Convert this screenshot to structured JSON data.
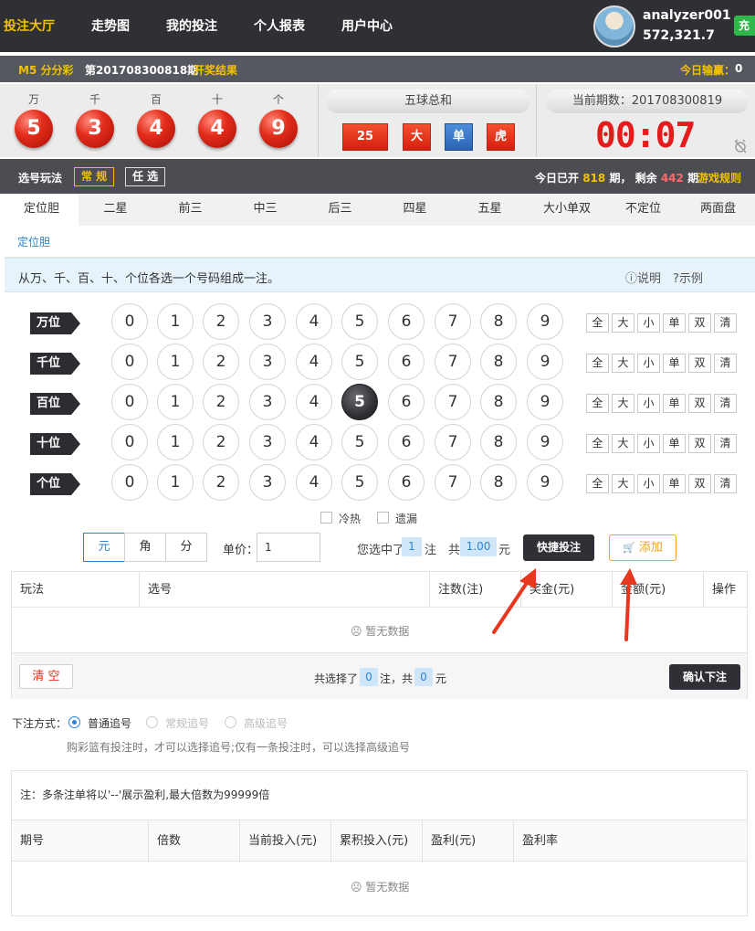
{
  "nav": {
    "items": [
      "投注大厅",
      "走势图",
      "我的投注",
      "个人报表",
      "用户中心"
    ],
    "username": "analyzer001",
    "balance": "572,321.7",
    "recharge": "充"
  },
  "subbar": {
    "game": "M5 分分彩",
    "issue": "第201708300818期",
    "result_label": "开奖结果",
    "today_profit_label": "今日输赢：",
    "today_profit": "0"
  },
  "result": {
    "positions": [
      "万",
      "千",
      "百",
      "十",
      "个"
    ],
    "balls": [
      "5",
      "3",
      "4",
      "4",
      "9"
    ],
    "sum_title": "五球总和",
    "sum_values": [
      "25",
      "大",
      "单",
      "虎"
    ],
    "period_label": "当前期数：201708300819",
    "countdown": "00:07"
  },
  "mode": {
    "label": "选号玩法",
    "normal": "常 规",
    "optional": "任 选",
    "today_prefix": "今日已开",
    "opened": "818",
    "mid": "期， 剩余",
    "remaining": "442",
    "suffix": "期",
    "rules": "游戏规则"
  },
  "tabs": [
    "定位胆",
    "二星",
    "前三",
    "中三",
    "后三",
    "四星",
    "五星",
    "大小单双",
    "不定位",
    "两面盘"
  ],
  "subtab": "定位胆",
  "info": {
    "text": "从万、千、百、十、个位各选一个号码组成一注。",
    "explain": "说明",
    "example": "示例"
  },
  "grid": {
    "rows": [
      "万位",
      "千位",
      "百位",
      "十位",
      "个位"
    ],
    "numbers": [
      "0",
      "1",
      "2",
      "3",
      "4",
      "5",
      "6",
      "7",
      "8",
      "9"
    ],
    "quick": [
      "全",
      "大",
      "小",
      "单",
      "双",
      "清"
    ],
    "selected": {
      "row": 2,
      "number": 5
    }
  },
  "options": {
    "hot_cold": "冷热",
    "missing": "遗漏"
  },
  "units": [
    "元",
    "角",
    "分"
  ],
  "price": {
    "label": "单价：",
    "value": "1"
  },
  "selection": {
    "prefix": "您选中了",
    "count": "1",
    "unit": "注",
    "total_prefix": "共",
    "amount": "1.00",
    "currency": "元"
  },
  "buttons": {
    "quick_bet": "快捷投注",
    "add": "添加",
    "clear": "清 空",
    "confirm": "确认下注"
  },
  "cart": {
    "headers": [
      "玩法",
      "选号",
      "注数(注)",
      "奖金(元)",
      "金额(元)",
      "操作"
    ],
    "empty": "暂无数据",
    "footer_prefix": "共选择了",
    "footer_count": "0",
    "footer_mid": "注，共",
    "footer_amount": "0",
    "footer_suffix": "元"
  },
  "bet_mode": {
    "label": "下注方式：",
    "options": [
      "普通追号",
      "常规追号",
      "高级追号"
    ],
    "hint": "购彩篮有投注时，才可以选择追号;仅有一条投注时，可以选择高级追号"
  },
  "chase": {
    "note": "注：多条注单将以'--'展示盈利,最大倍数为99999倍",
    "headers": [
      "期号",
      "倍数",
      "当前投入(元)",
      "累积投入(元)",
      "盈利(元)",
      "盈利率"
    ],
    "empty": "暂无数据"
  },
  "colors": {
    "accent": "#f2c200",
    "primary": "#2c83d3",
    "ball_red": "#e42d1c",
    "countdown": "#e61c1c"
  }
}
